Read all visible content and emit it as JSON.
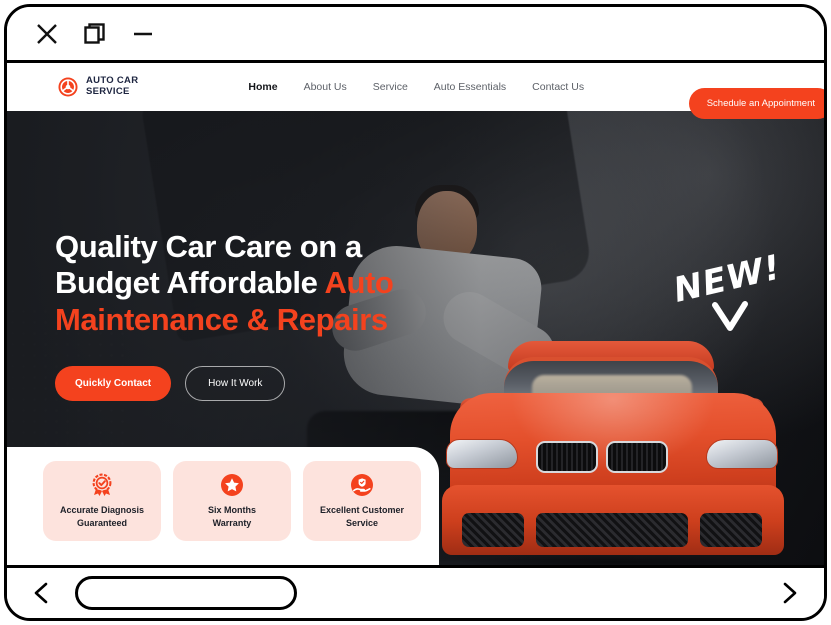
{
  "window": {
    "controls": [
      {
        "name": "close",
        "icon": "close-icon"
      },
      {
        "name": "restore",
        "icon": "restore-window-icon"
      },
      {
        "name": "minimize",
        "icon": "minimize-icon"
      }
    ]
  },
  "site": {
    "logo": {
      "icon": "steering-wheel-icon",
      "line1": "AUTO CAR",
      "line2": "SERVICE"
    },
    "nav": [
      {
        "label": "Home",
        "active": true
      },
      {
        "label": "About Us",
        "active": false
      },
      {
        "label": "Service",
        "active": false
      },
      {
        "label": "Auto Essentials",
        "active": false
      },
      {
        "label": "Contact Us",
        "active": false
      }
    ],
    "cta_label": "Schedule an Appointment"
  },
  "hero": {
    "headline_line1": "Quality Car Care on a",
    "headline_line2_plain": "Budget Affordable ",
    "headline_line2_accent": "Auto",
    "headline_line3_accent": "Maintenance & Repairs",
    "primary_button": "Quickly Contact",
    "secondary_button": "How It Work",
    "sticker_text": "NEW!"
  },
  "features": [
    {
      "icon": "quality-badge-icon",
      "line1": "Accurate Diagnosis",
      "line2": "Guaranteed"
    },
    {
      "icon": "star-icon",
      "line1": "Six Months",
      "line2": "Warranty"
    },
    {
      "icon": "customer-care-icon",
      "line1": "Excellent Customer",
      "line2": "Service"
    }
  ],
  "browser_bottom": {
    "back_label": "<",
    "forward_label": ">",
    "address_value": "",
    "address_placeholder": ""
  },
  "colors": {
    "accent_orange": "#f4421e",
    "card_pink": "#fde3dd",
    "navy_text": "#1d2540",
    "hero_dark": "#2a2d33"
  }
}
